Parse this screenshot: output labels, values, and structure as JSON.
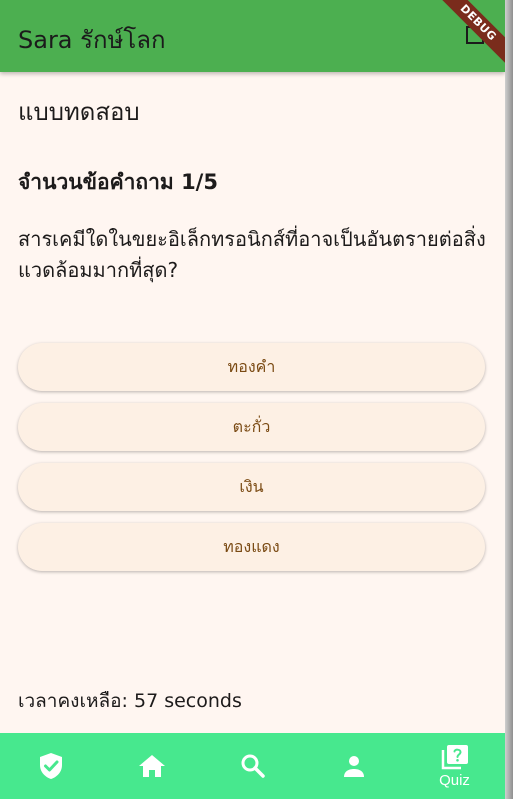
{
  "appbar": {
    "title": "Sara รักษ์โลก",
    "debug_banner": "DEBUG"
  },
  "screen": {
    "title": "แบบทดสอบ",
    "counter": "จำนวนข้อคำถาม 1/5",
    "question": "สารเคมีใดในขยะอิเล็กทรอนิกส์ที่อาจเป็นอันตรายต่อสิ่งแวดล้อมมากที่สุด?",
    "answers": [
      "ทองคำ",
      "ตะกั่ว",
      "เงิน",
      "ทองแดง"
    ],
    "timer": "เวลาคงเหลือ: 57 seconds"
  },
  "bottom_nav": {
    "items": [
      {
        "icon": "shield-check-icon",
        "label": ""
      },
      {
        "icon": "home-icon",
        "label": ""
      },
      {
        "icon": "search-icon",
        "label": ""
      },
      {
        "icon": "person-icon",
        "label": ""
      },
      {
        "icon": "quiz-icon",
        "label": "Quiz"
      }
    ]
  },
  "colors": {
    "appbar": "#4caf50",
    "background": "#fff6f1",
    "answer_button": "#fdf0e4",
    "answer_text": "#7a4a13",
    "bottom_nav": "#47e88e",
    "debug_ribbon": "#7a2c1c"
  }
}
